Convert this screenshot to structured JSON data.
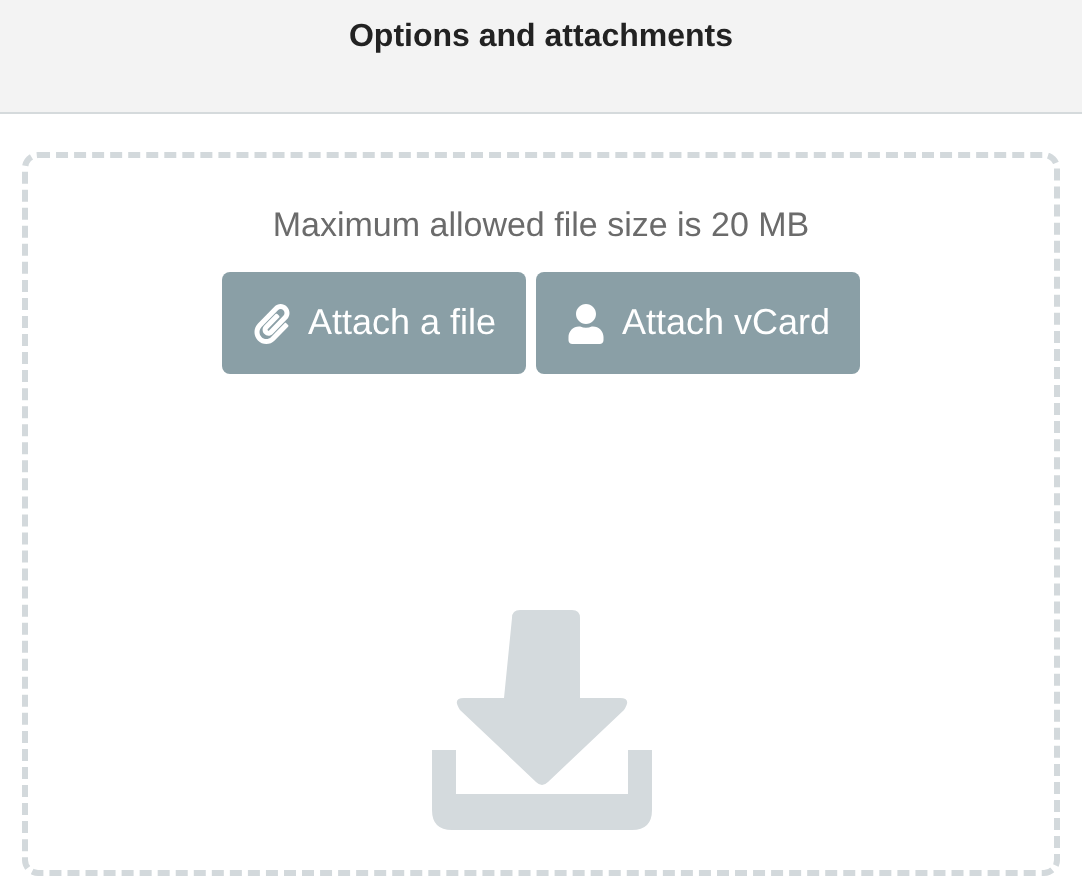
{
  "header": {
    "title": "Options and attachments"
  },
  "dropzone": {
    "note": "Maximum allowed file size is 20 MB",
    "buttons": [
      {
        "label": "Attach a file",
        "kind": "file"
      },
      {
        "label": "Attach vCard",
        "kind": "vcard"
      }
    ]
  }
}
